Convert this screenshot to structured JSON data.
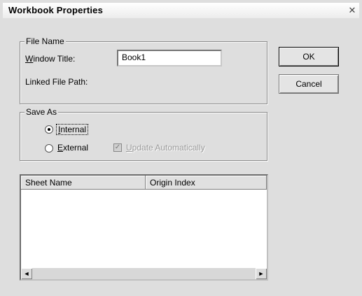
{
  "dialog": {
    "title": "Workbook Properties",
    "close_glyph": "✕"
  },
  "file_name_group": {
    "title": "File Name",
    "window_title_label_access": "W",
    "window_title_label_rest": "indow Title:",
    "window_title_value": "Book1",
    "linked_file_path_label": "Linked File Path:"
  },
  "save_as_group": {
    "title": "Save As",
    "internal_access": "I",
    "internal_rest": "nternal",
    "internal_selected": true,
    "external_access": "E",
    "external_rest": "xternal",
    "external_selected": false,
    "update_auto_access": "U",
    "update_auto_rest": "pdate Automatically",
    "update_auto_checked": true,
    "update_auto_enabled": false
  },
  "sheet_table": {
    "columns": [
      "Sheet Name",
      "Origin Index"
    ],
    "rows": []
  },
  "buttons": {
    "ok_label": "OK",
    "cancel_label": "Cancel"
  },
  "icons": {
    "radio": "radio-button",
    "checkbox": "checkbox-icon",
    "scroll_left": "◄",
    "scroll_right": "►"
  }
}
